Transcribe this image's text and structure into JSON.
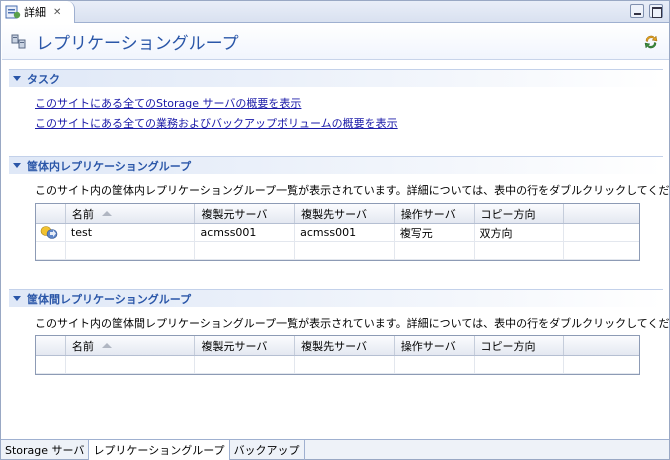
{
  "window_tab": {
    "label": "詳細",
    "close_symbol": "✕"
  },
  "header": {
    "title": "レプリケーショングループ"
  },
  "tasks": {
    "title": "タスク",
    "links": [
      "このサイトにある全てのStorage サーバの概要を表示",
      "このサイトにある全ての業務およびバックアップボリュームの概要を表示"
    ]
  },
  "intra": {
    "title": "筐体内レプリケーショングループ",
    "description": "このサイト内の筐体内レプリケーショングループ一覧が表示されています。詳細については、表中の行をダブルクリックしてください。",
    "columns": [
      "名前",
      "複製元サーバ",
      "複製先サーバ",
      "操作サーバ",
      "コピー方向"
    ],
    "rows": [
      {
        "name": "test",
        "source": "acmss001",
        "target": "acmss001",
        "operator": "複写元",
        "direction": "双方向"
      }
    ]
  },
  "inter": {
    "title": "筐体間レプリケーショングループ",
    "description": "このサイト内の筐体間レプリケーショングループ一覧が表示されています。詳細については、表中の行をダブルクリックしてください。",
    "columns": [
      "名前",
      "複製元サーバ",
      "複製先サーバ",
      "操作サーバ",
      "コピー方向"
    ],
    "rows": []
  },
  "bottom_tabs": [
    "Storage サーバ",
    "レプリケーショングループ",
    "バックアップ"
  ],
  "active_bottom_tab": 1,
  "colors": {
    "accent": "#2a56a8",
    "link": "#1a1aa8"
  },
  "icons": [
    "details-view-icon",
    "close-icon",
    "minimize-icon",
    "maximize-icon",
    "replication-group-icon",
    "refresh-icon",
    "collapse-triangle-icon",
    "sort-ascending-icon",
    "replication-row-icon"
  ]
}
